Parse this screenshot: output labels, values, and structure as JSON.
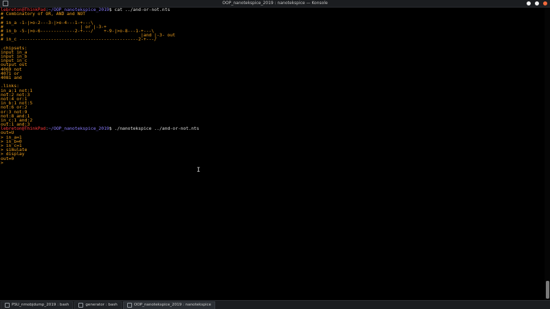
{
  "window": {
    "title": "OOP_nanotekspice_2019 : nanotekspice — Konsole",
    "buttons": [
      "minimize",
      "maximize",
      "close"
    ]
  },
  "prompt": {
    "user_host": "lebreton@ThinkPad",
    "sep": ":",
    "path": "~/OOP_nanotekspice_2019",
    "dollar": "$"
  },
  "terminal": {
    "cmd1": "cat ../and-or-not.nts",
    "lines1": [
      "# Combinatory of OR, AND and NOT",
      "#",
      "# in_a -1-|>o-2---3-|>o-4---1-+---\\",
      "#                             | or |-3-+",
      "# in_b -5-|>o-6-------------2-+---/    +-9-|>o-8---1-+---\\",
      "#                                                    |and |-3- out",
      "# in_c ---------------------------------------------2-+---/",
      "",
      ".chipsets:",
      "input in_a",
      "input in_b",
      "input in_c",
      "output out",
      "4069 not",
      "4071 or",
      "4081 and",
      "",
      ".links:",
      "in_a:1 not:1",
      "not:2 not:3",
      "not:4 or:1",
      "in_b:1 not:5",
      "not:6 or:2",
      "or:3 not:9",
      "not:8 and:1",
      "in_c:1 and:2",
      "out:1 and:3"
    ],
    "cmd2": "./nanotekspice ../and-or-not.nts",
    "lines2": [
      "out=U",
      "> in_a=1",
      "> in_b=0",
      "> in_c=1",
      "> simulate",
      "> display",
      "out=0",
      "> "
    ]
  },
  "taskbar": {
    "tabs": [
      {
        "label": "PSU_nmobjdump_2019 : bash",
        "active": false
      },
      {
        "label": "generator : bash",
        "active": false
      },
      {
        "label": "OOP_nanotekspice_2019 : nanotekspice",
        "active": true
      }
    ]
  },
  "colors": {
    "output": "#f2a21f",
    "user_host": "#ff3a3a",
    "path": "#8a7cff",
    "close": "#f26a3c"
  }
}
